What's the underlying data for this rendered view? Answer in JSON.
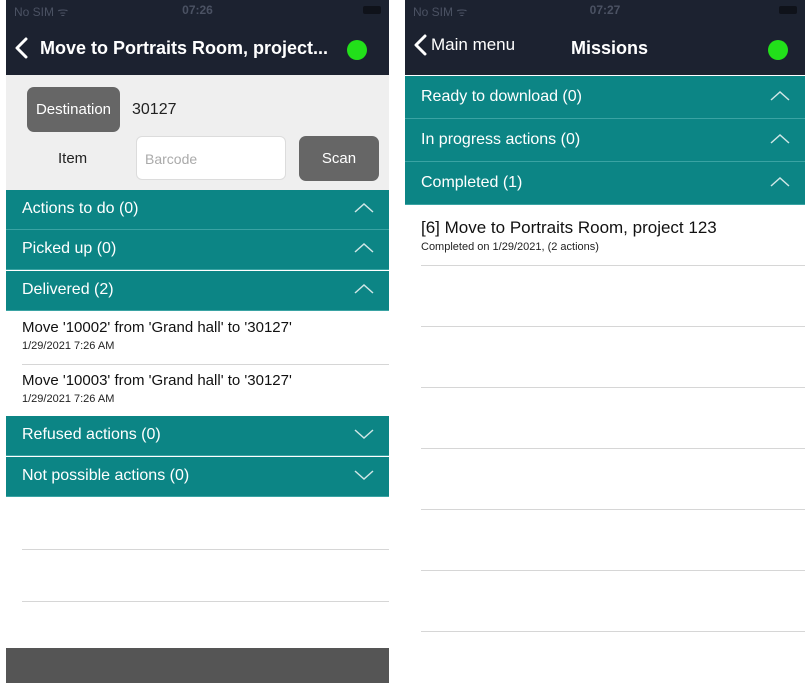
{
  "left": {
    "status": {
      "carrier": "No SIM ᯤ",
      "time": "07:26"
    },
    "nav": {
      "back_icon": "chevron-left-icon",
      "title": "Move to Portraits Room, project...",
      "status_dot_color": "#22e01a"
    },
    "form": {
      "destination_label": "Destination",
      "destination_value": "30127",
      "item_label": "Item",
      "barcode_placeholder": "Barcode",
      "scan_label": "Scan"
    },
    "sections": {
      "actions_to_do": "Actions to do (0)",
      "picked_up": "Picked up (0)",
      "delivered": "Delivered (2)",
      "refused": "Refused actions (0)",
      "not_possible": "Not possible actions (0)"
    },
    "delivered_items": [
      {
        "title": "Move '10002' from 'Grand hall' to '30127'",
        "time": "1/29/2021 7:26 AM"
      },
      {
        "title": "Move '10003' from 'Grand hall' to '30127'",
        "time": "1/29/2021 7:26 AM"
      }
    ]
  },
  "right": {
    "status": {
      "carrier": "No SIM ᯤ",
      "time": "07:27"
    },
    "nav": {
      "back_label": "Main menu",
      "title": "Missions",
      "status_dot_color": "#22e01a"
    },
    "sections": {
      "ready": "Ready to download (0)",
      "in_progress": "In progress actions (0)",
      "completed": "Completed (1)"
    },
    "completed_items": [
      {
        "title": "[6] Move to Portraits Room, project 123",
        "subtitle": "Completed on 1/29/2021, (2 actions)"
      }
    ]
  },
  "colors": {
    "teal": "#0c8585",
    "navbar": "#1c2230",
    "button_gray": "#666666"
  }
}
